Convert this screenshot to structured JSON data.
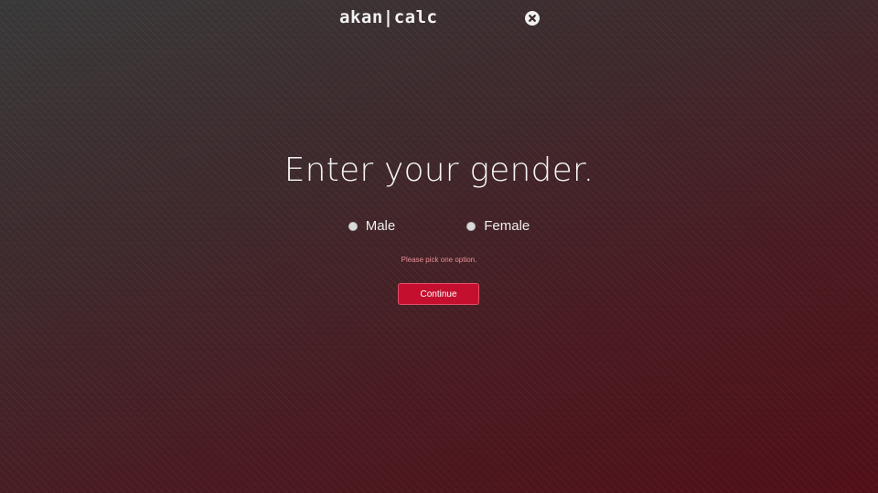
{
  "header": {
    "brand": "akan|calc",
    "close_icon": "close-circle-icon"
  },
  "main": {
    "title": "Enter your gender.",
    "options": [
      {
        "label": "Male"
      },
      {
        "label": "Female"
      }
    ],
    "error": "Please pick one option.",
    "continue_label": "Continue"
  },
  "colors": {
    "button": "#c4102e",
    "error_text": "#e88f98",
    "background_top": "#3a3a3a",
    "background_bottom": "#520f18"
  }
}
